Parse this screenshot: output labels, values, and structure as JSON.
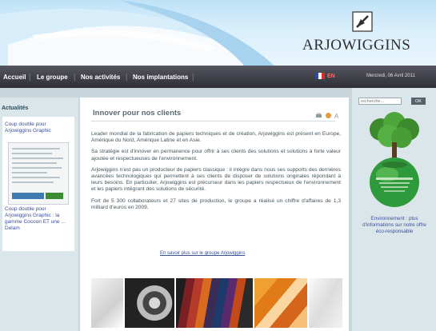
{
  "header": {
    "brand": "ARJOWIGGINS"
  },
  "nav": {
    "items": [
      "Accueil",
      "Le groupe",
      "Nos activités",
      "Nos implantations"
    ],
    "language": "EN",
    "date": "Mercredi, 06 Avril 2011",
    "flag_colors": [
      "#2f4da0",
      "#ffffff",
      "#d8312c"
    ]
  },
  "sidebar_left": {
    "title": "Actualités",
    "news": [
      {
        "label": "Coup double pour Arjowiggins Graphic"
      },
      {
        "label": "Coup double pour Arjowiggins Graphic : la gamme Cocoon ET une ... Delam"
      }
    ]
  },
  "main": {
    "title": "Innover pour nos clients",
    "paragraphs": [
      "Leader mondial de la fabrication de papiers techniques et de création, Arjowiggins est présent en Europe, Amérique du Nord, Amérique Latine et en Asie.",
      "Sa stratégie est d'innover en permanence pour offrir à ses clients des solutions et solutions à forte valeur ajoutée et respectueuses de l'environnement.",
      "Arjowiggins n'est pas un producteur de papiers classique : il intègre dans nous ses supports des dernières avancées technologiques qui permettent à ses clients de disposer de solutions originales répondant à leurs besoins. En particulier, Arjowiggins est précurseur dans les papiers respectueux de l'environnement et les papiers intégrant des solutions de sécurité.",
      "Fort de 5 300 collaborateurs et 27 sites de production, le groupe a réalisé un chiffre d'affaires de 1,3 milliard d'euros en 2009."
    ],
    "more_link": "En savoir plus sur le groupe Arjowiggins"
  },
  "sidebar_right": {
    "search_placeholder": "recherche...",
    "search_button": "OK",
    "eco_caption": "Environnement : plus d'informations sur notre offre éco-responsable"
  },
  "colors": {
    "navbar": "#3a3a44",
    "accent_link": "#3a4f99",
    "page_bg": "#c9d7dd"
  }
}
